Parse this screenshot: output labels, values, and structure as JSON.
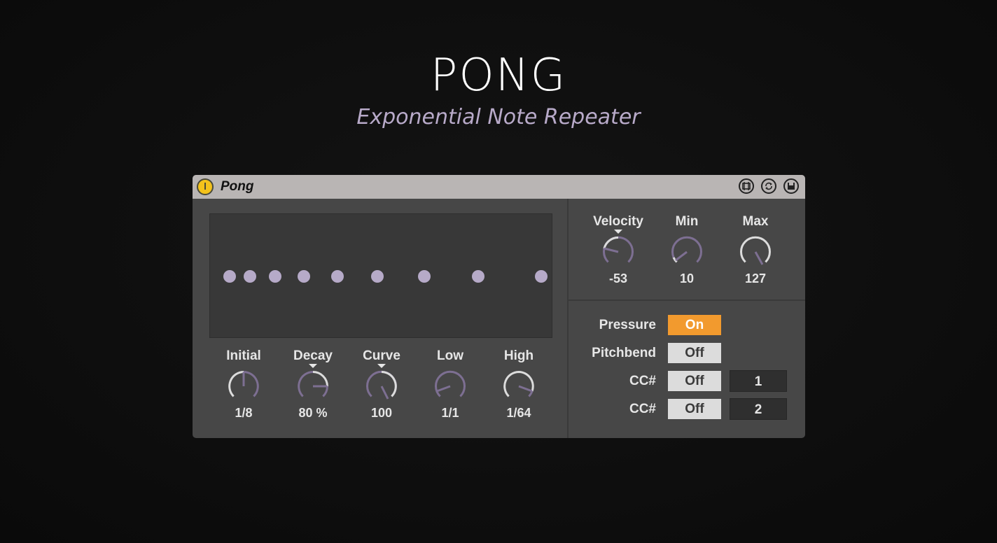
{
  "header": {
    "title": "PONG",
    "subtitle": "Exponential Note Repeater"
  },
  "device": {
    "name": "Pong",
    "colors": {
      "accent_on": "#f29a2e",
      "dot": "#b6aac8",
      "power": "#f3c21b"
    },
    "titlebar_icons": [
      "hot-swap-icon",
      "refresh-icon",
      "save-icon"
    ]
  },
  "rhythm_knobs": [
    {
      "label": "Initial",
      "value": "1/8"
    },
    {
      "label": "Decay",
      "value": "80 %"
    },
    {
      "label": "Curve",
      "value": "100"
    },
    {
      "label": "Low",
      "value": "1/1"
    },
    {
      "label": "High",
      "value": "1/64"
    }
  ],
  "velocity_knobs": [
    {
      "label": "Velocity",
      "value": "-53"
    },
    {
      "label": "Min",
      "value": "10"
    },
    {
      "label": "Max",
      "value": "127"
    }
  ],
  "modulation": {
    "pressure": {
      "label": "Pressure",
      "state": "On"
    },
    "pitchbend": {
      "label": "Pitchbend",
      "state": "Off"
    },
    "cc1": {
      "label": "CC#",
      "state": "Off",
      "number": "1"
    },
    "cc2": {
      "label": "CC#",
      "state": "Off",
      "number": "2"
    }
  }
}
